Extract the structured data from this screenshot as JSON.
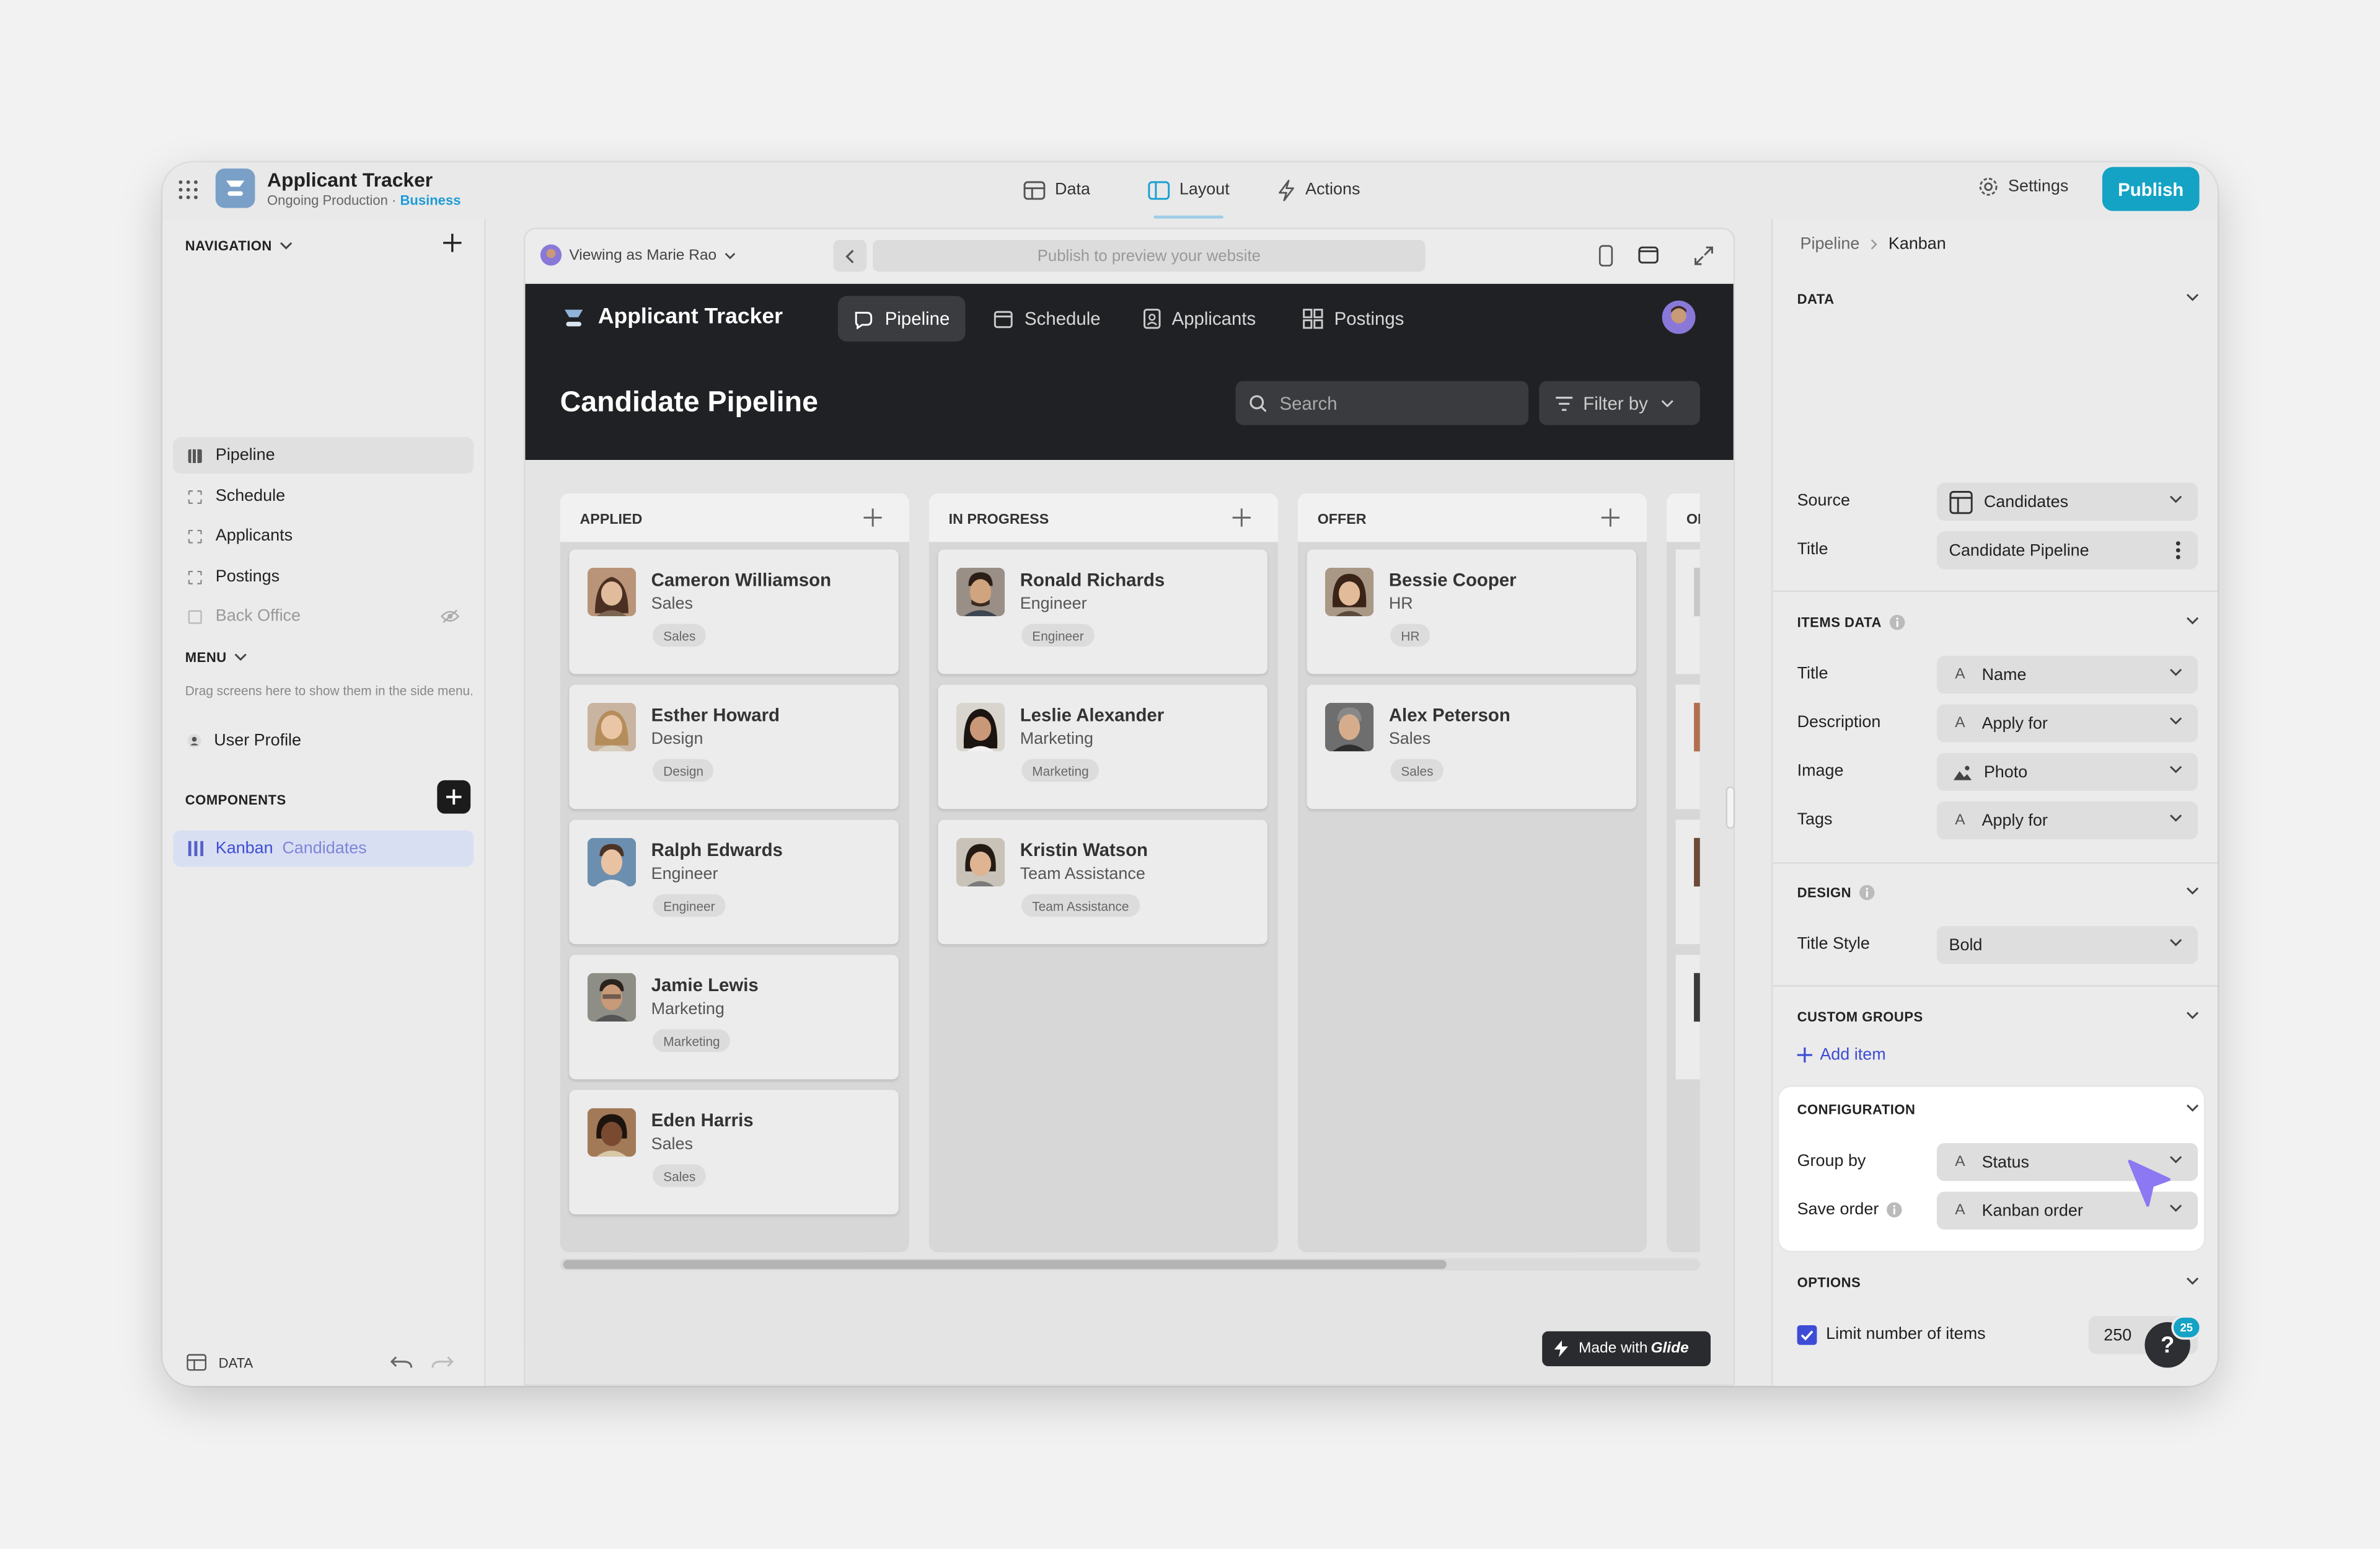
{
  "window": {
    "app_name": "Applicant Tracker",
    "app_subtitle": "Ongoing Production · ",
    "app_plan": "Business",
    "top_tabs": {
      "data": "Data",
      "layout": "Layout",
      "actions": "Actions"
    },
    "settings": "Settings",
    "publish": "Publish"
  },
  "sidebar": {
    "navigation_heading": "NAVIGATION",
    "nav_items": [
      "Pipeline",
      "Schedule",
      "Applicants",
      "Postings",
      "Back Office"
    ],
    "menu_heading": "MENU",
    "menu_hint": "Drag screens here to show them in the side menu.",
    "menu_items": [
      "User Profile"
    ],
    "components_heading": "COMPONENTS",
    "component": {
      "type": "Kanban",
      "source": "Candidates"
    },
    "footer_data": "DATA"
  },
  "preview": {
    "viewing_as": "Viewing as ",
    "viewer": "Marie Rao",
    "url_placeholder": "Publish to preview your website",
    "app_title": "Applicant Tracker",
    "tabs": [
      "Pipeline",
      "Schedule",
      "Applicants",
      "Postings"
    ],
    "page_title": "Candidate Pipeline",
    "search_placeholder": "Search",
    "filter": "Filter by",
    "made_with": "Made with ",
    "made_with_brand": "Glide",
    "columns": [
      {
        "title": "APPLIED",
        "cards": [
          {
            "name": "Cameron Williamson",
            "role": "Sales",
            "tag": "Sales"
          },
          {
            "name": "Esther Howard",
            "role": "Design",
            "tag": "Design"
          },
          {
            "name": "Ralph Edwards",
            "role": "Engineer",
            "tag": "Engineer"
          },
          {
            "name": "Jamie Lewis",
            "role": "Marketing",
            "tag": "Marketing"
          },
          {
            "name": "Eden Harris",
            "role": "Sales",
            "tag": "Sales"
          }
        ]
      },
      {
        "title": "IN PROGRESS",
        "cards": [
          {
            "name": "Ronald Richards",
            "role": "Engineer",
            "tag": "Engineer"
          },
          {
            "name": "Leslie Alexander",
            "role": "Marketing",
            "tag": "Marketing"
          },
          {
            "name": "Kristin Watson",
            "role": "Team Assistance",
            "tag": "Team Assistance"
          }
        ]
      },
      {
        "title": "OFFER",
        "cards": [
          {
            "name": "Bessie Cooper",
            "role": "HR",
            "tag": "HR"
          },
          {
            "name": "Alex Peterson",
            "role": "Sales",
            "tag": "Sales"
          }
        ]
      },
      {
        "title": "OI",
        "cards": []
      }
    ]
  },
  "panel": {
    "breadcrumb": [
      "Pipeline",
      "Kanban"
    ],
    "data": {
      "heading": "DATA",
      "source_label": "Source",
      "source_value": "Candidates",
      "title_label": "Title",
      "title_value": "Candidate Pipeline"
    },
    "items_data": {
      "heading": "ITEMS DATA",
      "rows": [
        {
          "label": "Title",
          "value": "Name"
        },
        {
          "label": "Description",
          "value": "Apply for"
        },
        {
          "label": "Image",
          "value": "Photo"
        },
        {
          "label": "Tags",
          "value": "Apply for"
        }
      ]
    },
    "design": {
      "heading": "DESIGN",
      "label": "Title Style",
      "value": "Bold"
    },
    "custom_groups": {
      "heading": "CUSTOM GROUPS",
      "add_item": "Add item"
    },
    "configuration": {
      "heading": "CONFIGURATION",
      "group_by_label": "Group by",
      "group_by_value": "Status",
      "save_order_label": "Save order",
      "save_order_value": "Kanban order"
    },
    "options": {
      "heading": "OPTIONS",
      "limit_label": "Limit number of items",
      "limit_checked": true,
      "limit_value": "250"
    },
    "help_badge": "25"
  },
  "colors": {
    "accent": "#14a3c4",
    "plan": "#1c9bd6",
    "link": "#3d4cd6",
    "cursor": "#8b78f2",
    "dark_header": "#202124"
  }
}
